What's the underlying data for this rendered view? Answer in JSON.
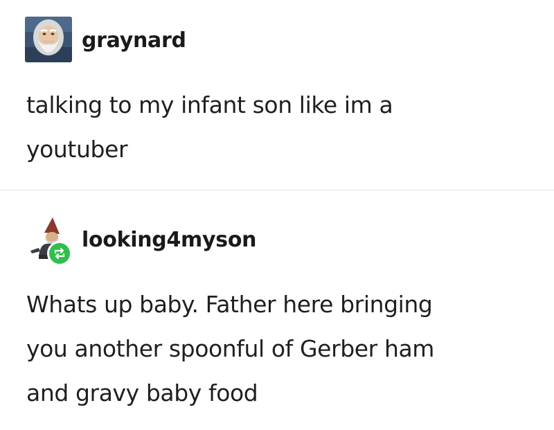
{
  "posts": [
    {
      "username": "graynard",
      "avatar": "old-wizard-avatar",
      "text_lines": [
        "talking to my infant son like im a",
        "youtuber"
      ]
    },
    {
      "username": "looking4myson",
      "avatar": "garden-gnome-avatar",
      "badge": "reblog-icon",
      "text_lines": [
        "Whats up baby. Father here bringing",
        "you another spoonful of Gerber ham",
        "and gravy baby food"
      ]
    }
  ],
  "colors": {
    "reblog_badge": "#2fbf4c",
    "text": "#1f1f1f",
    "divider": "#e2e2e2"
  }
}
